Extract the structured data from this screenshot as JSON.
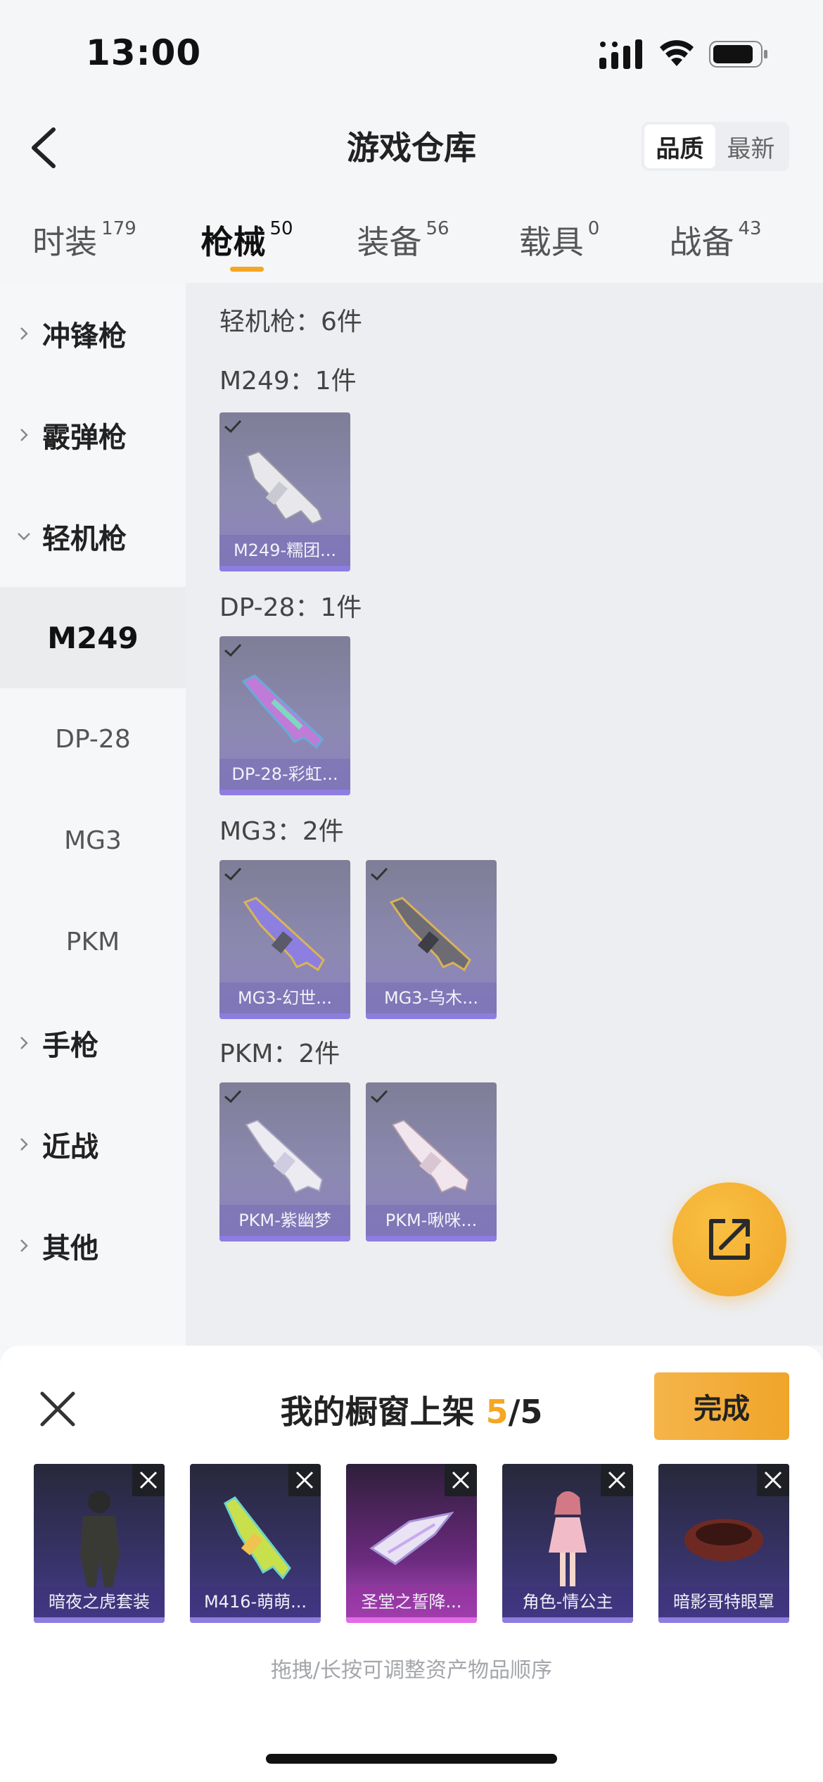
{
  "status": {
    "time": "13:00"
  },
  "nav": {
    "title": "游戏仓库",
    "sort": [
      "品质",
      "最新"
    ]
  },
  "tabs": [
    {
      "label": "时装",
      "count": "179"
    },
    {
      "label": "枪械",
      "count": "50"
    },
    {
      "label": "装备",
      "count": "56"
    },
    {
      "label": "载具",
      "count": "0"
    },
    {
      "label": "战备",
      "count": "43"
    }
  ],
  "sidebar": {
    "categories": [
      "冲锋枪",
      "霰弹枪",
      "轻机枪",
      "手枪",
      "近战",
      "其他"
    ],
    "subitems": [
      "M249",
      "DP-28",
      "MG3",
      "PKM"
    ]
  },
  "content": {
    "heading": "轻机枪：6件",
    "groups": [
      {
        "title": "M249：1件",
        "items": [
          "M249-糯团..."
        ]
      },
      {
        "title": "DP-28：1件",
        "items": [
          "DP-28-彩虹..."
        ]
      },
      {
        "title": "MG3：2件",
        "items": [
          "MG3-幻世...",
          "MG3-乌木..."
        ]
      },
      {
        "title": "PKM：2件",
        "items": [
          "PKM-紫幽梦",
          "PKM-啾咪..."
        ]
      }
    ]
  },
  "sheet": {
    "title": "我的橱窗上架",
    "count_current": "5",
    "count_total": "/5",
    "done_label": "完成",
    "items": [
      "暗夜之虎套装",
      "M416-萌萌...",
      "圣堂之誓降...",
      "角色-情公主",
      "暗影哥特眼罩"
    ],
    "hint": "拖拽/长按可调整资产物品顺序"
  },
  "colors": {
    "accent": "#f5a623",
    "card_purple": "#8e7de0",
    "card_pink": "#e36ce6"
  }
}
